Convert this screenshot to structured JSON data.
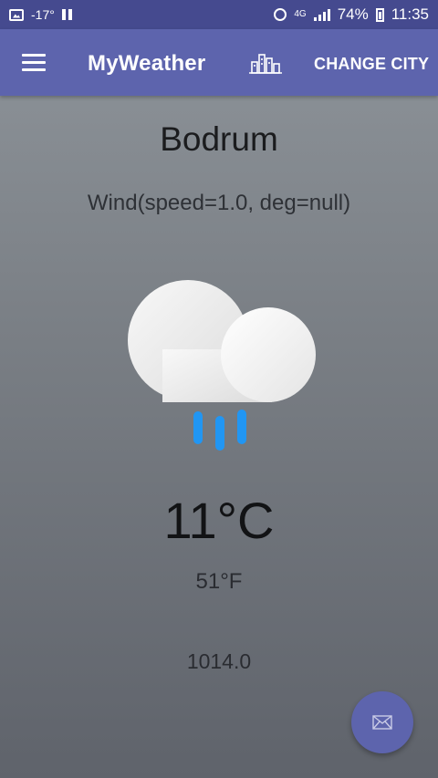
{
  "status_bar": {
    "temperature": "-17°",
    "network": "4G",
    "battery": "74%",
    "time": "11:35"
  },
  "app_bar": {
    "title": "MyWeather",
    "change_city_label": "CHANGE CITY"
  },
  "weather": {
    "city": "Bodrum",
    "wind": "Wind(speed=1.0, deg=null)",
    "icon": "rain-cloud-icon",
    "temp_c": "11°C",
    "temp_f": "51°F",
    "pressure": "1014.0"
  },
  "colors": {
    "status_bar": "#454a8f",
    "app_bar": "#5d64ad",
    "rain": "#2196f3",
    "fab": "#5d64ad"
  }
}
